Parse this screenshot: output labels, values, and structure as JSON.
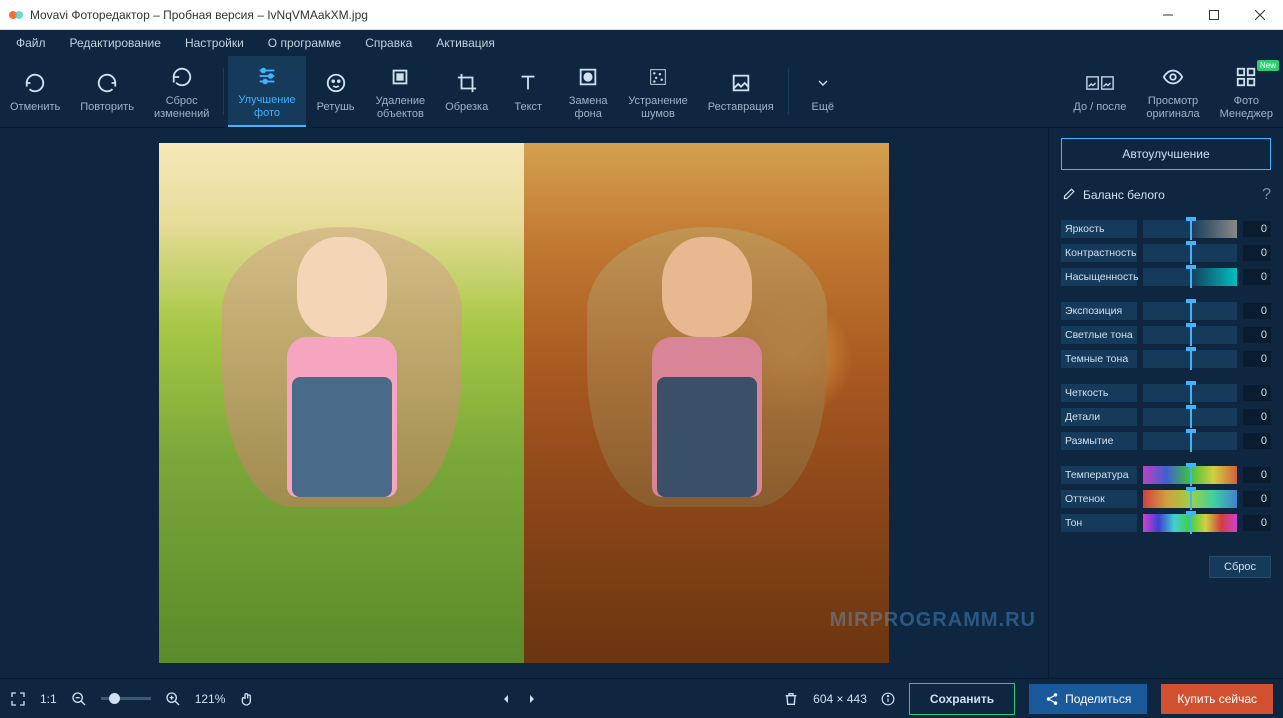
{
  "window": {
    "title": "Movavi Фоторедактор – Пробная версия – IvNqVMAakXM.jpg"
  },
  "menu": {
    "items": [
      "Файл",
      "Редактирование",
      "Настройки",
      "О программе",
      "Справка",
      "Активация"
    ]
  },
  "toolbar": {
    "undo": "Отменить",
    "redo": "Повторить",
    "reset": "Сброс\nизменений",
    "enhance": "Улучшение\nфото",
    "retouch": "Ретушь",
    "remove": "Удаление\nобъектов",
    "crop": "Обрезка",
    "text": "Текст",
    "bgremove": "Замена\nфона",
    "denoise": "Устранение\nшумов",
    "restore": "Реставрация",
    "more": "Ещё",
    "beforeafter": "До / после",
    "original": "Просмотр\nоригинала",
    "manager": "Фото\nМенеджер",
    "new_badge": "New"
  },
  "sidebar": {
    "auto": "Автоулучшение",
    "whitebalance": "Баланс белого",
    "sliders": {
      "brightness": {
        "label": "Яркость",
        "value": "0"
      },
      "contrast": {
        "label": "Контрастность",
        "value": "0"
      },
      "saturation": {
        "label": "Насыщенность",
        "value": "0"
      },
      "exposure": {
        "label": "Экспозиция",
        "value": "0"
      },
      "highlights": {
        "label": "Светлые тона",
        "value": "0"
      },
      "shadows": {
        "label": "Темные тона",
        "value": "0"
      },
      "sharpness": {
        "label": "Четкость",
        "value": "0"
      },
      "details": {
        "label": "Детали",
        "value": "0"
      },
      "blur": {
        "label": "Размытие",
        "value": "0"
      },
      "temperature": {
        "label": "Температура",
        "value": "0"
      },
      "tint": {
        "label": "Оттенок",
        "value": "0"
      },
      "hue": {
        "label": "Тон",
        "value": "0"
      }
    },
    "reset": "Сброс"
  },
  "bottom": {
    "ratio": "1:1",
    "zoom": "121%",
    "dimensions": "604 × 443",
    "save": "Сохранить",
    "share": "Поделиться",
    "buy": "Купить сейчас"
  },
  "watermark": "MIRPROGRAMM.RU"
}
